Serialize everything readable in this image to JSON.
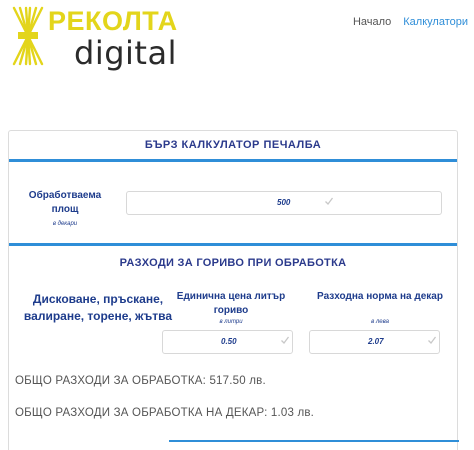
{
  "logo": {
    "top_text": "РЕКОЛТА",
    "bottom_text": "digital"
  },
  "nav": {
    "items": [
      {
        "label": "Начало"
      },
      {
        "label": "Калкулатори"
      }
    ]
  },
  "calculator": {
    "title": "БЪРЗ КАЛКУЛАТОР ПЕЧАЛБА",
    "area": {
      "label": "Обработваема площ",
      "unit": "в декари",
      "value": "500"
    },
    "fuel_section_title": "РАЗХОДИ ЗА ГОРИВО ПРИ ОБРАБОТКА",
    "operations_label": "Дисковане, пръскане, валиране, торене, жътва",
    "price": {
      "label": "Единична цена литър гориво",
      "unit": "в литри",
      "value": "0.50"
    },
    "rate": {
      "label": "Разходна норма на декар",
      "unit": "в лева",
      "value": "2.07"
    },
    "total_cost": "ОБЩО РАЗХОДИ ЗА ОБРАБОТКА: 517.50 лв.",
    "total_cost_per_decare": "ОБЩО РАЗХОДИ ЗА ОБРАБОТКА НА ДЕКАР: 1.03 лв."
  },
  "colors": {
    "brand_yellow": "#e3d51b",
    "brand_blue": "#2b3a8c",
    "accent_blue": "#2f8ed8",
    "nav_link": "#2f8ed8"
  }
}
